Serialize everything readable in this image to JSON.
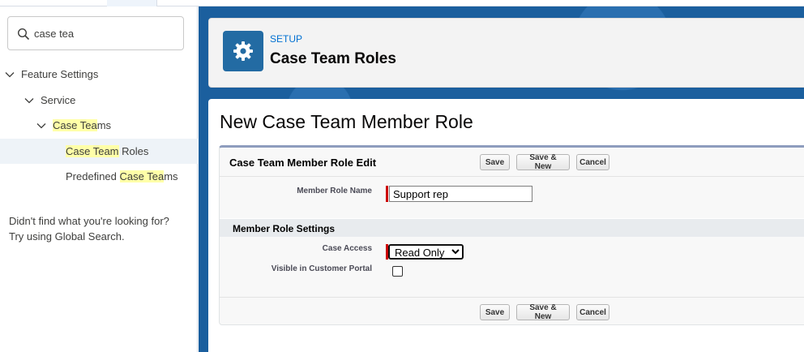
{
  "sidebar": {
    "search": {
      "value": "case tea",
      "icon": "search-icon"
    },
    "tree": [
      {
        "label": "Feature Settings",
        "pre": "",
        "hl": "",
        "post": ""
      },
      {
        "label": "Service",
        "pre": "",
        "hl": "",
        "post": ""
      },
      {
        "label": "",
        "pre": "",
        "hl": "Case Tea",
        "post": "ms"
      },
      {
        "label": "",
        "pre": "",
        "hl": "Case Team",
        "post": " Roles"
      },
      {
        "label": "",
        "pre": "Predefined ",
        "hl": "Case Tea",
        "post": "ms"
      }
    ],
    "help_line1": "Didn't find what you're looking for?",
    "help_line2": "Try using Global Search."
  },
  "header": {
    "setup_label": "SETUP",
    "title": "Case Team Roles",
    "icon": "gear-icon"
  },
  "main": {
    "page_title": "New Case Team Member Role",
    "block_title": "Case Team Member Role Edit",
    "buttons": {
      "save": "Save",
      "save_new": "Save & New",
      "cancel": "Cancel"
    },
    "fields": {
      "member_role_name_label": "Member Role Name",
      "member_role_name_value": "Support rep",
      "section_title": "Member Role Settings",
      "case_access_label": "Case Access",
      "case_access_value": "Read Only",
      "visible_portal_label": "Visible in Customer Portal",
      "visible_portal_checked": false
    }
  },
  "colors": {
    "brand_blue": "#1b5f9e",
    "icon_bg": "#236ba3",
    "link": "#0070d2",
    "highlight": "#ffffa8",
    "required": "#cc0000"
  }
}
